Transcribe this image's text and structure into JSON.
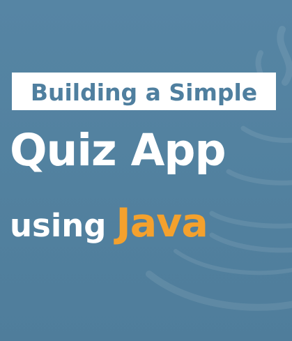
{
  "title_banner": {
    "text": "Building a Simple",
    "background": "#ffffff",
    "text_color": "#4f7f9f"
  },
  "headline": {
    "text": "Quiz App",
    "color": "#ffffff"
  },
  "subline": {
    "prefix": "using",
    "highlight": "Java",
    "prefix_color": "#ffffff",
    "highlight_color": "#f4a12d"
  },
  "background": {
    "color": "#52809f",
    "watermark_icon": "java-coffee-cup-icon"
  }
}
